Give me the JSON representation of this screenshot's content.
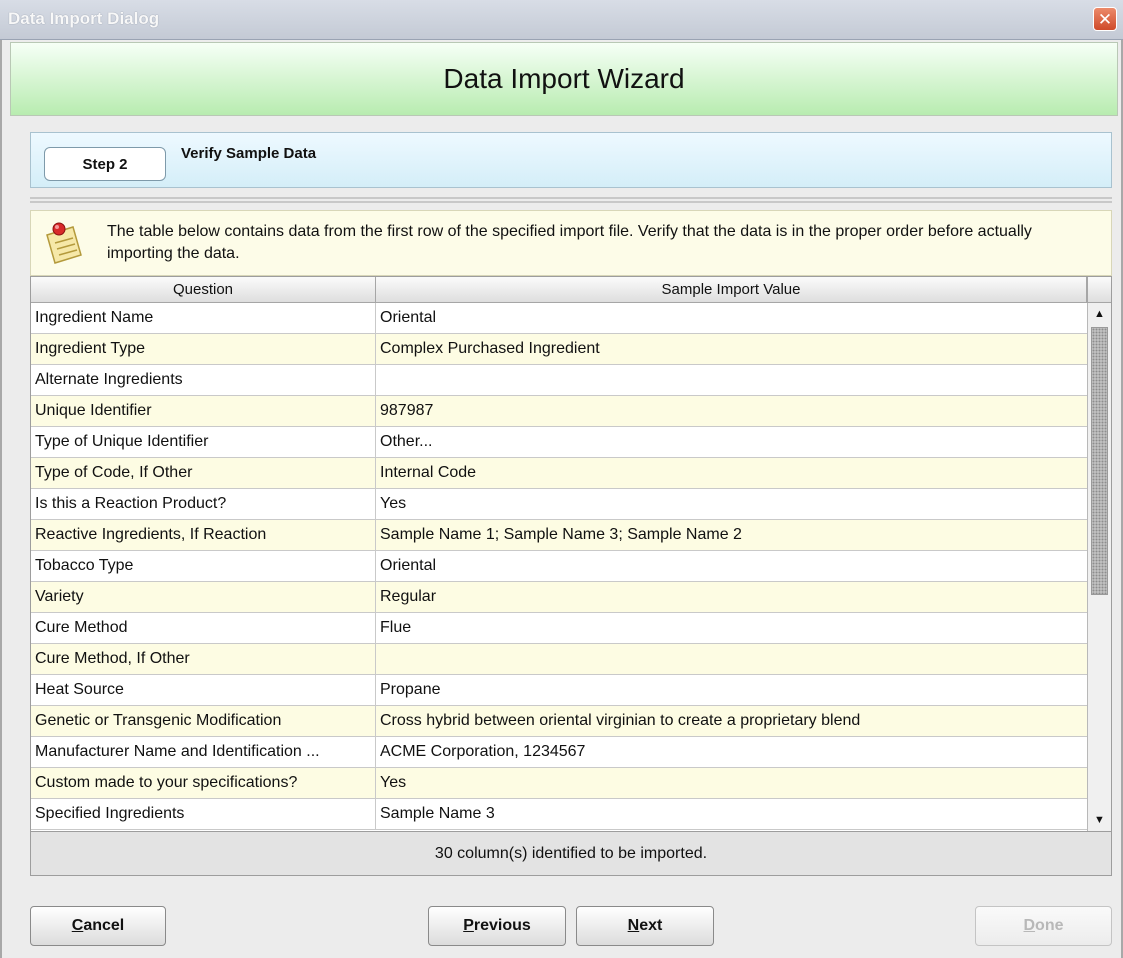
{
  "window": {
    "title": "Data Import Dialog",
    "close_glyph": "✕"
  },
  "header": {
    "title": "Data Import Wizard"
  },
  "step": {
    "badge": "Step 2",
    "label": "Verify Sample Data"
  },
  "info": {
    "icon": "note-pin-icon",
    "text": "The table below contains data from the first row of the  specified import file.  Verify that the data is in the proper order before actually importing the data."
  },
  "table": {
    "headers": [
      "Question",
      "Sample Import Value"
    ],
    "rows": [
      {
        "q": "Ingredient Name",
        "v": "Oriental"
      },
      {
        "q": "Ingredient Type",
        "v": "Complex Purchased Ingredient"
      },
      {
        "q": "Alternate Ingredients",
        "v": ""
      },
      {
        "q": "Unique Identifier",
        "v": "987987"
      },
      {
        "q": "Type of Unique Identifier",
        "v": "Other..."
      },
      {
        "q": "Type of Code, If Other",
        "v": "Internal Code"
      },
      {
        "q": "Is this a Reaction Product?",
        "v": "Yes"
      },
      {
        "q": "Reactive Ingredients, If Reaction",
        "v": "Sample Name 1; Sample Name 3; Sample Name 2"
      },
      {
        "q": "Tobacco Type",
        "v": "Oriental"
      },
      {
        "q": "Variety",
        "v": "Regular"
      },
      {
        "q": "Cure Method",
        "v": "Flue"
      },
      {
        "q": "Cure Method, If Other",
        "v": ""
      },
      {
        "q": "Heat Source",
        "v": "Propane"
      },
      {
        "q": "Genetic or Transgenic Modification",
        "v": "Cross hybrid between oriental virginian to create a proprietary blend"
      },
      {
        "q": "Manufacturer Name and Identification ...",
        "v": "ACME Corporation, 1234567"
      },
      {
        "q": "Custom made to your specifications?",
        "v": "Yes"
      },
      {
        "q": "Specified Ingredients",
        "v": "Sample Name 3"
      }
    ]
  },
  "status": {
    "text": "30 column(s) identified to be imported."
  },
  "buttons": {
    "cancel": {
      "first": "C",
      "rest": "ancel"
    },
    "previous": {
      "first": "P",
      "rest": "revious"
    },
    "next": {
      "first": "N",
      "rest": "ext"
    },
    "done": {
      "first": "D",
      "rest": "one"
    }
  },
  "colors": {
    "header_green": "#b8ecb0",
    "odd_row": "#fdfce3",
    "step_blue": "#d4eef8"
  }
}
